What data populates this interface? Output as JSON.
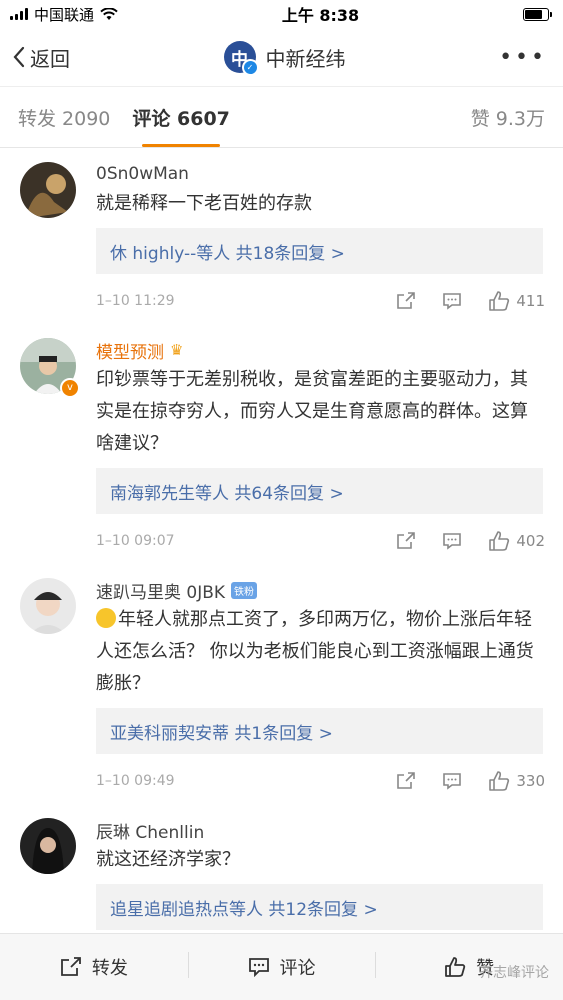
{
  "status": {
    "carrier": "中国联通",
    "time": "上午 8:38"
  },
  "nav": {
    "back": "返回",
    "account": "中新经纬"
  },
  "tabs": {
    "repost": "转发 2090",
    "comment": "评论 6607",
    "like": "赞 9.3万"
  },
  "comments": [
    {
      "name": "0Sn0wMan",
      "text": "就是稀释一下老百姓的存款",
      "replies": "休 highly--等人 共18条回复 >",
      "time": "1–10 11:29",
      "likes": "411"
    },
    {
      "name": "模型预测",
      "text": "印钞票等于无差别税收，是贫富差距的主要驱动力，其实是在掠夺穷人，而穷人又是生育意愿高的群体。这算啥建议？",
      "replies": "南海郭先生等人 共64条回复 >",
      "time": "1–10 09:07",
      "likes": "402"
    },
    {
      "name": "速趴马里奥 0JBK",
      "badge": "铁粉",
      "text": "年轻人就那点工资了，多印两万亿，物价上涨后年轻人还怎么活？ 你以为老板们能良心到工资涨幅跟上通货膨胀？",
      "replies": "亚美科丽契安蒂 共1条回复 >",
      "time": "1–10 09:49",
      "likes": "330"
    },
    {
      "name": "辰琳 Chenllin",
      "text": "就这还经济学家？",
      "replies": "追星追剧追热点等人 共12条回复 >"
    }
  ],
  "bottom": {
    "repost": "转发",
    "comment": "评论",
    "like": "赞"
  },
  "watermark": "齐志峰评论",
  "icons": [
    "signal-icon",
    "wifi-icon",
    "battery-icon",
    "back-chevron-icon",
    "verified-icon",
    "more-icon",
    "share-icon",
    "comment-icon",
    "like-icon"
  ],
  "colors": {
    "accent": "#f08300",
    "link": "#4a6ea9",
    "vip_name": "#e8730c"
  }
}
